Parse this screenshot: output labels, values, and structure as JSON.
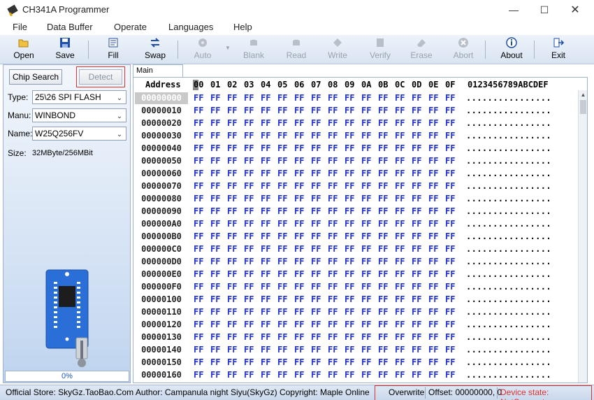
{
  "window": {
    "title": "CH341A Programmer"
  },
  "menu": [
    "File",
    "Data Buffer",
    "Operate",
    "Languages",
    "Help"
  ],
  "toolbar": [
    {
      "label": "Open",
      "icon": "folder-open-icon",
      "enabled": true
    },
    {
      "label": "Save",
      "icon": "floppy-disk-icon",
      "enabled": true
    },
    {
      "label": "Fill",
      "icon": "fill-icon",
      "enabled": true
    },
    {
      "label": "Swap",
      "icon": "swap-arrows-icon",
      "enabled": true
    },
    {
      "label": "Auto",
      "icon": "gear-icon",
      "enabled": false
    },
    {
      "label": "Blank",
      "icon": "blank-icon",
      "enabled": false
    },
    {
      "label": "Read",
      "icon": "read-icon",
      "enabled": false
    },
    {
      "label": "Write",
      "icon": "write-icon",
      "enabled": false
    },
    {
      "label": "Verify",
      "icon": "verify-icon",
      "enabled": false
    },
    {
      "label": "Erase",
      "icon": "eraser-icon",
      "enabled": false
    },
    {
      "label": "Abort",
      "icon": "abort-icon",
      "enabled": false
    },
    {
      "label": "About",
      "icon": "info-icon",
      "enabled": true
    },
    {
      "label": "Exit",
      "icon": "exit-icon",
      "enabled": true
    }
  ],
  "left": {
    "chip_search": "Chip Search",
    "detect": "Detect",
    "type_label": "Type:",
    "type_value": "25\\26 SPI FLASH",
    "manu_label": "Manu:",
    "manu_value": "WINBOND",
    "name_label": "Name:",
    "name_value": "W25Q256FV",
    "size_label": "Size:",
    "size_value": "32MByte/256MBit",
    "progress": "0%"
  },
  "memory": {
    "tab": "Main Memory",
    "address_header": "Address",
    "columns": [
      "00",
      "01",
      "02",
      "03",
      "04",
      "05",
      "06",
      "07",
      "08",
      "09",
      "0A",
      "0B",
      "0C",
      "0D",
      "0E",
      "0F"
    ],
    "ascii_header": "0123456789ABCDEF",
    "rows": [
      "00000000",
      "00000010",
      "00000020",
      "00000030",
      "00000040",
      "00000050",
      "00000060",
      "00000070",
      "00000080",
      "00000090",
      "000000A0",
      "000000B0",
      "000000C0",
      "000000D0",
      "000000E0",
      "000000F0",
      "00000100",
      "00000110",
      "00000120",
      "00000130",
      "00000140",
      "00000150",
      "00000160"
    ],
    "byte_value": "FF",
    "ascii_row": "................"
  },
  "status": {
    "left": "Official Store: SkyGz.TaoBao.Com Author: Campanula night Siyu(SkyGz) Copyright: Maple Online",
    "mode": "Overwrite",
    "offset": "Offset: 00000000, 0",
    "device": "Device state: NotConnect"
  }
}
